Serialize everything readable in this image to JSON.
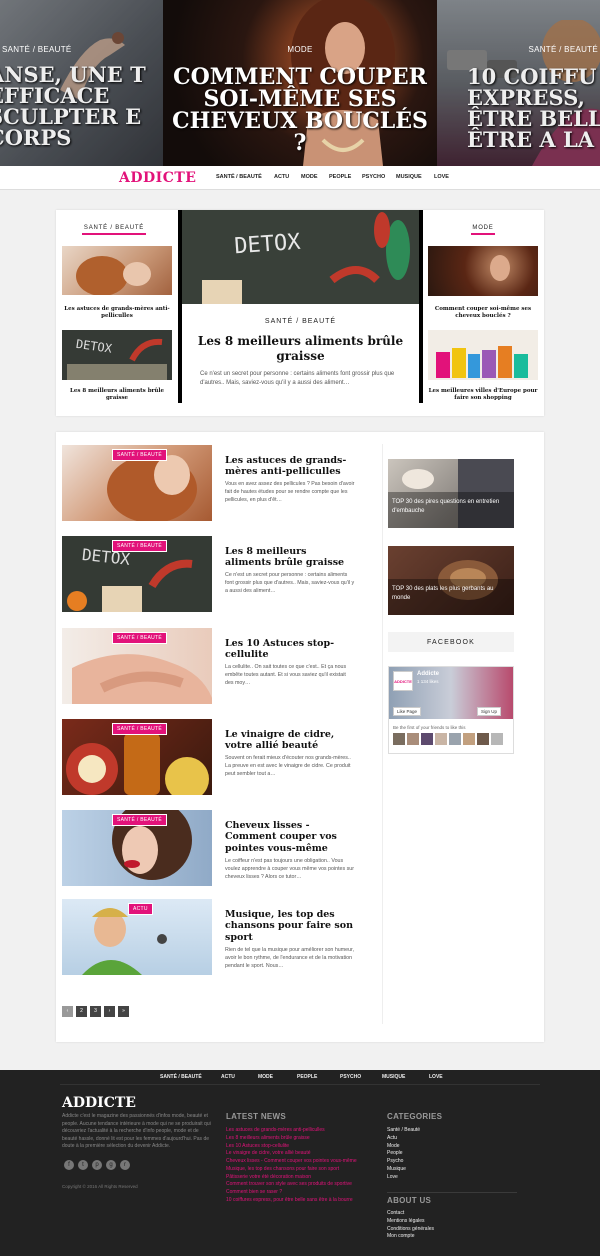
{
  "hero": {
    "left": {
      "category": "SANTÉ / BEAUTÉ",
      "title": "ANSE, UNE T EFFICACE SCULPTER E CORPS"
    },
    "center": {
      "category": "MODE",
      "title": "COMMENT COUPER SOI-MÊME SES CHEVEUX BOUCLÉS ?"
    },
    "right": {
      "category": "SANTÉ / BEAUTÉ",
      "title": "10 COIFFU EXPRESS, ÊTRE BELL ÊTRE A LA B"
    }
  },
  "nav": {
    "logo": "ADDICTE",
    "items": [
      "SANTÉ / BEAUTÉ",
      "ACTU",
      "MODE",
      "PEOPLE",
      "PSYCHO",
      "MUSIQUE",
      "LOVE"
    ]
  },
  "featured": {
    "left_heading": "SANTÉ / BEAUTÉ",
    "left_items": [
      "Les astuces de grands-mères anti-pelliculles",
      "Les 8 meilleurs aliments brûle graisse"
    ],
    "center": {
      "image_text": "DETOX",
      "category": "SANTÉ / BEAUTÉ",
      "title": "Les 8 meilleurs aliments brûle graisse",
      "excerpt": "Ce n'est un secret pour personne : certains aliments font grossir plus que d'autres.. Mais, saviez-vous qu'il y a aussi des aliment…"
    },
    "right_heading": "MODE",
    "right_items": [
      "Comment couper soi-même ses cheveux bouclés ?",
      "Les meilleures villes d'Europe pour faire son shopping"
    ]
  },
  "posts": [
    {
      "badge": "SANTÉ / BEAUTÉ",
      "title": "Les astuces de grands-mères anti-pelliculles",
      "excerpt": "Vous en avez assez des pellicules ? Pas besoin d'avoir fait de hautes études pour se rendre compte que les pellicules, en plus d'êt…"
    },
    {
      "badge": "SANTÉ / BEAUTÉ",
      "title": "Les 8 meilleurs aliments brûle graisse",
      "excerpt": "Ce n'est un secret pour personne : certains aliments font grossir plus que d'autres.. Mais, saviez-vous qu'il y a aussi des aliment…"
    },
    {
      "badge": "SANTÉ / BEAUTÉ",
      "title": "Les 10 Astuces stop-cellulite",
      "excerpt": "La cellulite.. On sait toutes ce que c'est.. Et ça nous embête toutes autant. Et si vous saviez qu'il existait des moy…"
    },
    {
      "badge": "SANTÉ / BEAUTÉ",
      "title": "Le vinaigre de cidre, votre allié beauté",
      "excerpt": "Souvent on ferait mieux d'écouter nos grands-mères.. La preuve en est avec le vinaigre de cidre. Ce produit peut sembler tout a…"
    },
    {
      "badge": "SANTÉ / BEAUTÉ",
      "title": "Cheveux lisses - Comment couper vos pointes vous-même",
      "excerpt": "Le coiffeur n'est pas toujours une obligation.. Vous voulez apprendre à couper vous même vos pointes sur cheveux lisses ? Alors ce tutor…"
    },
    {
      "badge": "ACTU",
      "title": "Musique, les top des chansons pour faire son sport",
      "excerpt": "Rien de tel que la musique pour améliorer son humeur, avoir le bon rythme, de l'endurance et de la motivation pendant le sport. Nous…"
    }
  ],
  "pagination": [
    "‹",
    "2",
    "3",
    "›",
    "»"
  ],
  "sidebar": {
    "items": [
      "TOP 30 des pires questions en entretien d'embauche",
      "TOP 30 des plats les plus gerbants au monde"
    ],
    "facebook_heading": "FACEBOOK",
    "fb_page": "Addicte",
    "fb_likes": "1 134 likes",
    "fb_like_btn": "Like Page",
    "fb_signup": "Sign Up",
    "fb_friends": "Be the first of your friends to like this"
  },
  "footer": {
    "nav": [
      "SANTÉ / BEAUTÉ",
      "ACTU",
      "MODE",
      "PEOPLE",
      "PSYCHO",
      "MUSIQUE",
      "LOVE"
    ],
    "logo": "ADDICTE",
    "about": "Addicte c'est le magazine des passionnés d'infos mode, beauté et people. Aucune tendance intérieure à mode qui ne se produirait qui découvriez l'actualité à la recherche d'info people, mode et de beauté hassle, donné lit est pour les femmes d'aujourd'hui. Pas de doute à la première sélection du devenir Addicte.",
    "social": [
      "f",
      "t",
      "p",
      "g",
      "r"
    ],
    "copyright": "Copyright © 2016 All Rights Reserved",
    "latest_heading": "LATEST NEWS",
    "latest": [
      "Les astuces de grands-mères anti-pelliculles",
      "Les 8 meilleurs aliments brûle graisse",
      "Les 10 Astuces stop-cellulite",
      "Le vinaigre de cidre, votre allié beauté",
      "Cheveux lisses - Comment couper vos pointes vous-même",
      "Musique, les top des chansons pour faire son sport",
      "Pâtisserie votre été décoration maison",
      "Comment trouver son style avec ses produits de sportive",
      "Comment bien se raser ?",
      "10 coiffures express, pour être belle sans être à la bourre"
    ],
    "categories_heading": "CATEGORIES",
    "categories": [
      "Santé / Beauté",
      "Actu",
      "Mode",
      "People",
      "Psycho",
      "Musique",
      "Love"
    ],
    "aboutus_heading": "ABOUT US",
    "aboutus": [
      "Contact",
      "Mentions légales",
      "Conditions générales",
      "Mon compte"
    ]
  }
}
